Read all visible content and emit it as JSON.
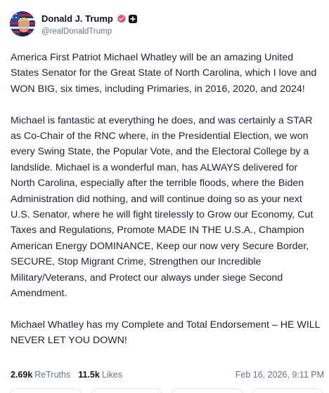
{
  "author": {
    "display_name": "Donald J. Trump",
    "handle": "@realDonaldTrump",
    "avatar": "avatar-flag-portrait",
    "verified_icon": "verified-badge-icon",
    "plus_icon": "plus-badge-icon",
    "verified_color": "#ee4d6a"
  },
  "post": {
    "paragraphs": [
      "America First Patriot Michael Whatley will be an amazing United States Senator for the Great State of North Carolina, which I love and WON BIG, six times, including Primaries, in 2016, 2020, and 2024!",
      "Michael is fantastic at everything he does, and was certainly a STAR as Co-Chair of the RNC where, in the Presidential Election, we won every Swing State, the Popular Vote, and the Electoral College by a landslide. Michael is a wonderful man, has ALWAYS delivered for North Carolina, especially after the terrible floods, where the Biden Administration did nothing, and will continue doing so as your next U.S. Senator, where he will fight tirelessly to Grow our Economy, Cut Taxes and Regulations, Promote MADE IN THE U.S.A., Champion American Energy DOMINANCE, Keep our now very Secure Border, SECURE, Stop Migrant Crime, Strengthen our Incredible Military/Veterans, and Protect our always under siege Second Amendment.",
      "Michael Whatley has my Complete and Total Endorsement – HE WILL NEVER LET YOU DOWN!"
    ]
  },
  "stats": {
    "retruths_count": "2.69k",
    "retruths_label": "ReTruths",
    "likes_count": "11.5k",
    "likes_label": "Likes",
    "timestamp": "Feb 16, 2026, 9:11 PM"
  }
}
